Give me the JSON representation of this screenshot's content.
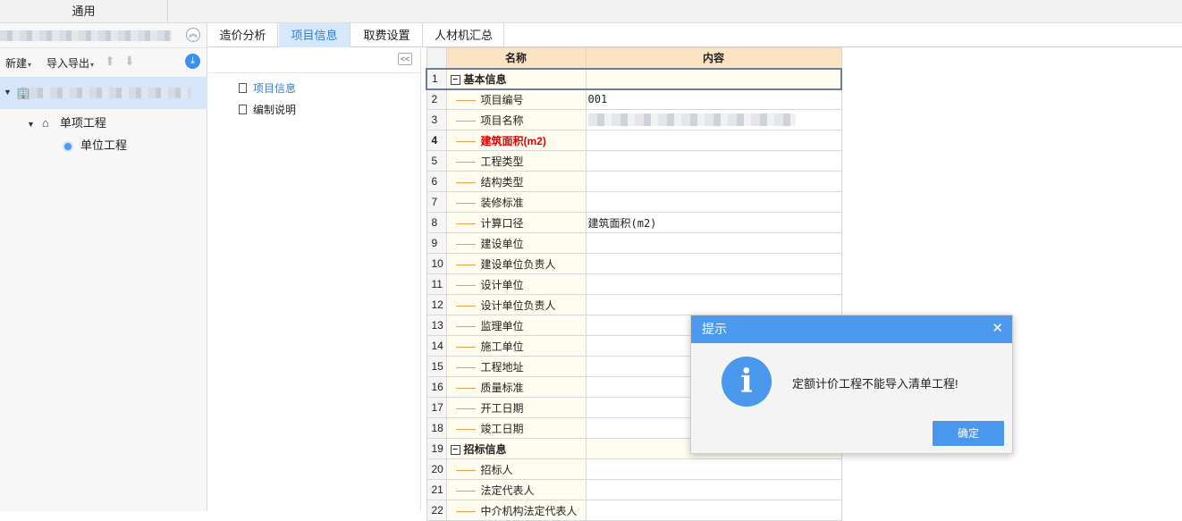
{
  "topbar": {
    "menu_label": "通用"
  },
  "left": {
    "toolbar": {
      "new_label": "新建",
      "import_export_label": "导入导出"
    },
    "tree": {
      "sub_project": "单项工程",
      "unit_project": "单位工程"
    }
  },
  "tabs": [
    {
      "label": "造价分析"
    },
    {
      "label": "项目信息"
    },
    {
      "label": "取费设置"
    },
    {
      "label": "人材机汇总"
    }
  ],
  "nav": {
    "items": [
      {
        "label": "项目信息"
      },
      {
        "label": "编制说明"
      }
    ]
  },
  "grid": {
    "headers": {
      "name": "名称",
      "content": "内容"
    },
    "rows": [
      {
        "n": "1",
        "name": "基本信息",
        "value": ""
      },
      {
        "n": "2",
        "name": "项目编号",
        "value": "001"
      },
      {
        "n": "3",
        "name": "项目名称",
        "value": ""
      },
      {
        "n": "4",
        "name": "建筑面积(m2)",
        "value": ""
      },
      {
        "n": "5",
        "name": "工程类型",
        "value": ""
      },
      {
        "n": "6",
        "name": "结构类型",
        "value": ""
      },
      {
        "n": "7",
        "name": "装修标准",
        "value": ""
      },
      {
        "n": "8",
        "name": "计算口径",
        "value": "建筑面积(m2)"
      },
      {
        "n": "9",
        "name": "建设单位",
        "value": ""
      },
      {
        "n": "10",
        "name": "建设单位负责人",
        "value": ""
      },
      {
        "n": "11",
        "name": "设计单位",
        "value": ""
      },
      {
        "n": "12",
        "name": "设计单位负责人",
        "value": ""
      },
      {
        "n": "13",
        "name": "监理单位",
        "value": ""
      },
      {
        "n": "14",
        "name": "施工单位",
        "value": ""
      },
      {
        "n": "15",
        "name": "工程地址",
        "value": ""
      },
      {
        "n": "16",
        "name": "质量标准",
        "value": ""
      },
      {
        "n": "17",
        "name": "开工日期",
        "value": ""
      },
      {
        "n": "18",
        "name": "竣工日期",
        "value": ""
      },
      {
        "n": "19",
        "name": "招标信息",
        "value": ""
      },
      {
        "n": "20",
        "name": "招标人",
        "value": ""
      },
      {
        "n": "21",
        "name": "法定代表人",
        "value": ""
      },
      {
        "n": "22",
        "name": "中介机构法定代表人",
        "value": ""
      }
    ]
  },
  "dialog": {
    "title": "提示",
    "close": "✕",
    "message": "定额计价工程不能导入清单工程!",
    "ok_label": "确定"
  },
  "colors": {
    "accent": "#4a97ee",
    "header_bg": "#fbe4c4",
    "name_bg": "#fffdf0",
    "highlight_text": "#e00000",
    "tab_active_bg": "#d7e8fb"
  },
  "icons": [
    "building-icon",
    "house-icon",
    "unit-dot-icon",
    "doc-icon",
    "info-icon",
    "close-icon",
    "download-icon",
    "arrow-up-icon",
    "arrow-down-icon",
    "double-chevron-up-icon",
    "double-chevron-left-icon"
  ]
}
